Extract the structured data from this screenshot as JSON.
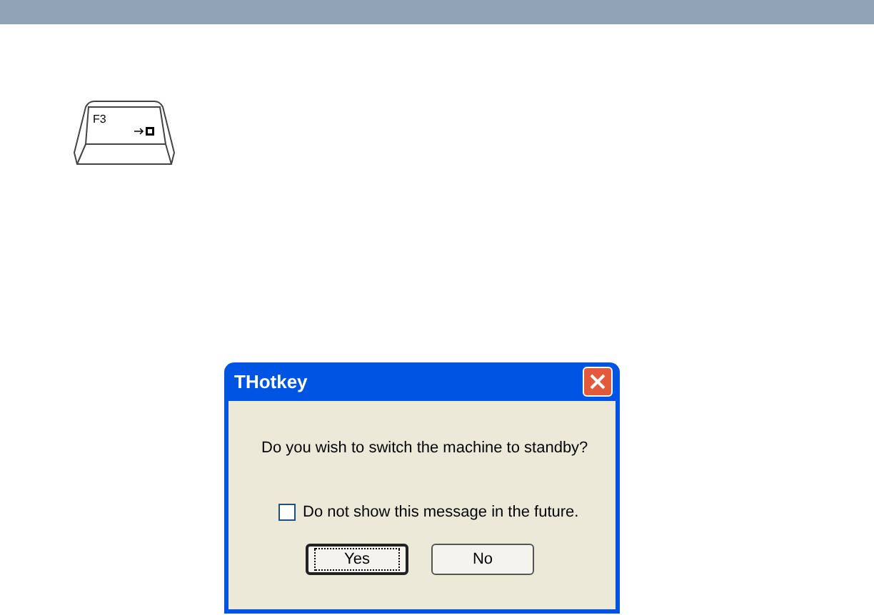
{
  "key": {
    "label": "F3"
  },
  "dialog": {
    "title": "THotkey",
    "message": "Do you wish to switch the machine to standby?",
    "checkbox": {
      "label": "Do not show this message in the future.",
      "checked": false
    },
    "buttons": [
      {
        "label": "Yes",
        "focused": true
      },
      {
        "label": "No",
        "focused": false
      }
    ]
  }
}
